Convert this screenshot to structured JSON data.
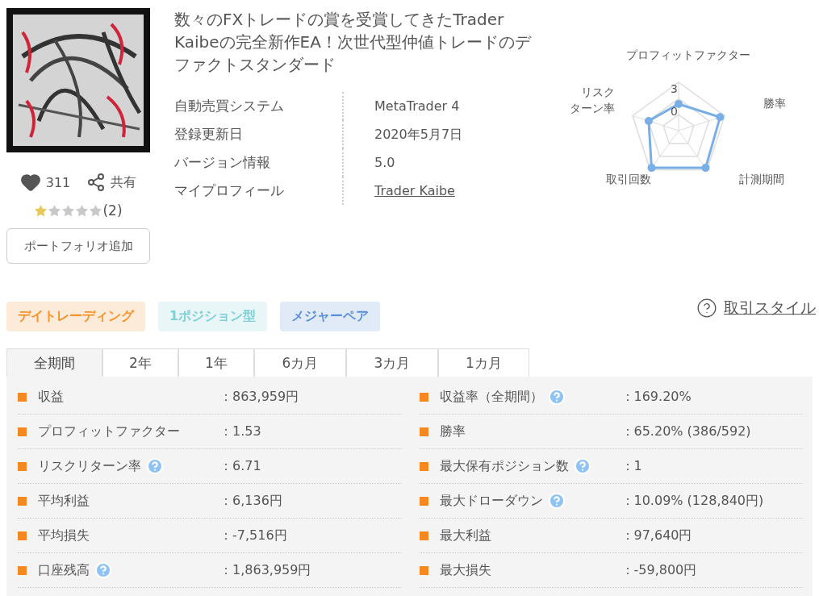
{
  "product": {
    "title": "数々のFXトレードの賞を受賞してきたTrader Kaibeの完全新作EA！次世代型仲値トレードのデファクトスタンダード",
    "likes": "311",
    "share": "共有",
    "stars": 1,
    "rating_count": "(2)",
    "portfolio_button": "ポートフォリオ追加"
  },
  "info": [
    {
      "label": "自動売買システム",
      "value": "MetaTrader 4",
      "kind": "text"
    },
    {
      "label": "登録更新日",
      "value": "2020年5月7日",
      "kind": "text"
    },
    {
      "label": "バージョン情報",
      "value": "5.0",
      "kind": "text"
    },
    {
      "label": "マイプロフィール",
      "value": "Trader Kaibe",
      "kind": "link"
    }
  ],
  "radar": {
    "axes": [
      {
        "lines": [
          "プロフィットファクター"
        ]
      },
      {
        "lines": [
          "勝率"
        ]
      },
      {
        "lines": [
          "計測期間"
        ]
      },
      {
        "lines": [
          "取引回数"
        ]
      },
      {
        "lines": [
          "リスク",
          "ターン率"
        ]
      }
    ],
    "tick_max": "3",
    "tick_min": "0"
  },
  "tags": [
    {
      "label": "デイトレーディング",
      "color": "#f5922a"
    },
    {
      "label": "1ポジション型",
      "color": "#7fcfd6"
    },
    {
      "label": "メジャーペア",
      "color": "#5b8ed8"
    }
  ],
  "style_link": "取引スタイル",
  "tabs": [
    {
      "label": "全期間",
      "selected": true
    },
    {
      "label": "2年",
      "selected": false
    },
    {
      "label": "1年",
      "selected": false
    },
    {
      "label": "6カ月",
      "selected": false
    },
    {
      "label": "3カ月",
      "selected": false
    },
    {
      "label": "1カ月",
      "selected": false
    }
  ],
  "stats_left": [
    {
      "label": "収益",
      "value": "：863,959円",
      "help": false
    },
    {
      "label": "プロフィットファクター",
      "value": "：1.53",
      "help": false
    },
    {
      "label": "リスクリターン率",
      "value": "：6.71",
      "help": true
    },
    {
      "label": "平均利益",
      "value": "：6,136円",
      "help": false
    },
    {
      "label": "平均損失",
      "value": "：-7,516円",
      "help": false
    },
    {
      "label": "口座残高",
      "value": "：1,863,959円",
      "help": true
    }
  ],
  "stats_right": [
    {
      "label": "収益率（全期間）",
      "value": "：169.20%",
      "help": true
    },
    {
      "label": "勝率",
      "value": "：65.20% (386/592)",
      "help": false
    },
    {
      "label": "最大保有ポジション数",
      "value": "：1",
      "help": true
    },
    {
      "label": "最大ドローダウン",
      "value": "：10.09% (128,840円)",
      "help": true
    },
    {
      "label": "最大利益",
      "value": "：97,640円",
      "help": false
    },
    {
      "label": "最大損失",
      "value": "：-59,800円",
      "help": false
    }
  ]
}
